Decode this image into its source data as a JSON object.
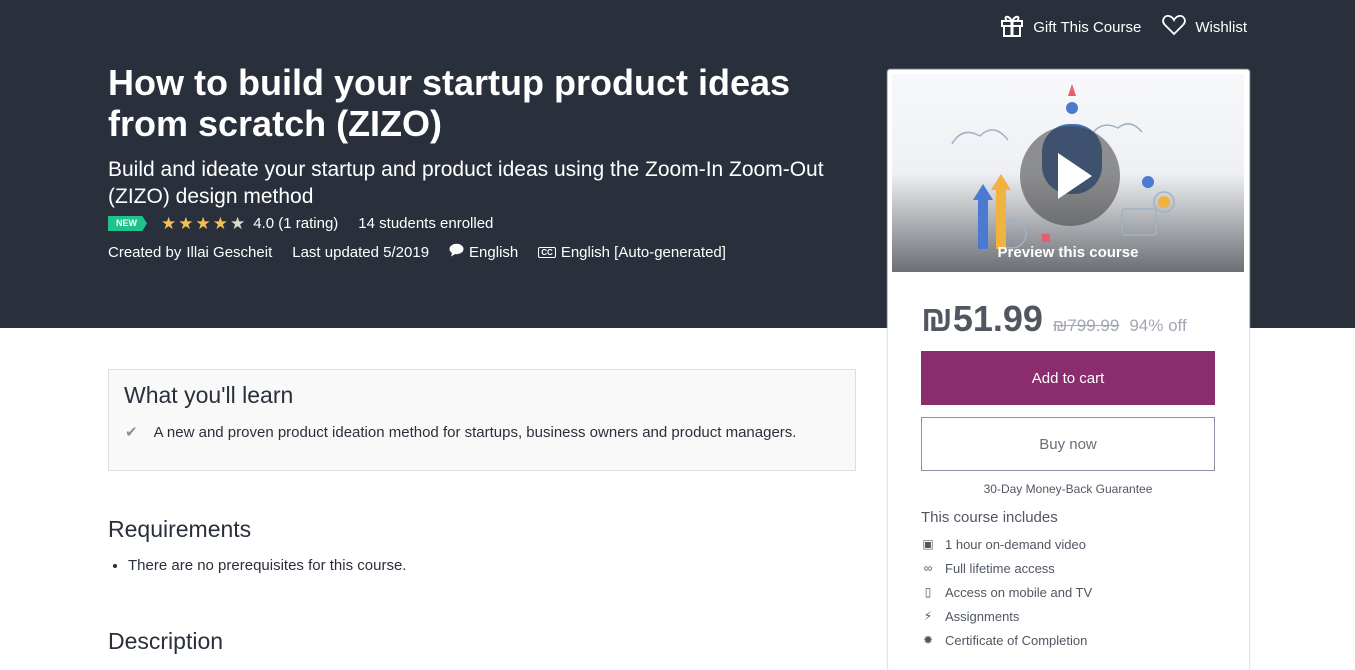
{
  "header": {
    "gift_label": "Gift This Course",
    "wishlist_label": "Wishlist"
  },
  "course": {
    "title": "How to build your startup product ideas from scratch (ZIZO)",
    "subtitle": "Build and ideate your startup and product ideas using the Zoom-In Zoom-Out (ZIZO) design method",
    "badge": "NEW",
    "rating_stars": 4,
    "rating_text": "4.0 (1 rating)",
    "enrolled": "14 students enrolled",
    "created_by_prefix": "Created by",
    "author": "Illai Gescheit",
    "last_updated": "Last updated 5/2019",
    "language": "English",
    "captions_badge": "CC",
    "captions": "English [Auto-generated]"
  },
  "learn": {
    "title": "What you'll learn",
    "points": [
      "A new and proven product ideation method for startups, business owners and product managers."
    ]
  },
  "requirements": {
    "title": "Requirements",
    "items": [
      "There are no prerequisites for this course."
    ]
  },
  "description": {
    "title": "Description"
  },
  "sidebar": {
    "preview_label": "Preview this course",
    "price": "₪51.99",
    "original_price": "₪799.99",
    "discount": "94% off",
    "add_to_cart": "Add to cart",
    "buy_now": "Buy now",
    "guarantee": "30-Day Money-Back Guarantee",
    "includes_title": "This course includes",
    "includes": [
      {
        "icon": "video-icon",
        "label": "1 hour on-demand video"
      },
      {
        "icon": "infinity-icon",
        "label": "Full lifetime access"
      },
      {
        "icon": "mobile-icon",
        "label": "Access on mobile and TV"
      },
      {
        "icon": "bolt-icon",
        "label": "Assignments"
      },
      {
        "icon": "certificate-icon",
        "label": "Certificate of Completion"
      }
    ]
  },
  "colors": {
    "hero_bg": "#29303b",
    "cart_button": "#8b2c6f",
    "star": "#f4c150",
    "badge": "#1ec28b"
  }
}
